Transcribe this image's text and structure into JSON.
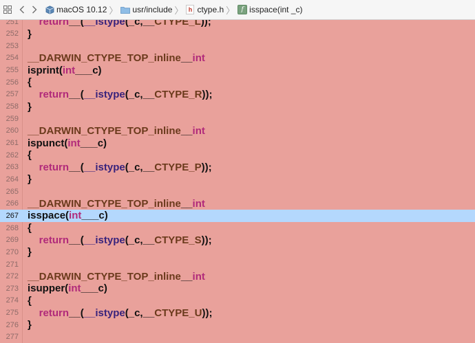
{
  "jumpbar": {
    "sdk": "macOS 10.12",
    "folder": "usr/include",
    "file": "ctype.h",
    "file_icon_glyph": "h",
    "symbol": "isspace(int _c)",
    "symbol_icon_glyph": "f",
    "icons": {
      "grid": "related-items-grid-icon",
      "back": "chevron-left-icon",
      "forward": "chevron-right-icon",
      "sdk": "sdk-box-icon",
      "folder": "folder-icon",
      "file": "header-file-icon",
      "symbol": "function-icon"
    }
  },
  "editor": {
    "current_line": "267",
    "colors": {
      "background": "#e9a19b",
      "current_line_highlight": "#b4d8fd",
      "keyword": "#b12a7a",
      "macro": "#6b3a1c",
      "identifier": "#39237c"
    },
    "lines": [
      {
        "num": "251",
        "t0": "    ",
        "t1": "return",
        "t2": "__(",
        "t3": "__istype",
        "t4": "(_c,__",
        "t5": "CTYPE_L",
        "t6": "));"
      },
      {
        "num": "252",
        "t0": "}",
        "t1": "",
        "t2": "",
        "t3": "",
        "t4": "",
        "t5": "",
        "t6": ""
      },
      {
        "num": "253",
        "t0": "",
        "t1": "",
        "t2": "",
        "t3": "",
        "t4": "",
        "t5": "",
        "t6": ""
      },
      {
        "num": "254",
        "t0": "",
        "t1": "__DARWIN_CTYPE_TOP_inline",
        "t2": "__",
        "t3": "int",
        "t4": "",
        "t5": "",
        "t6": ""
      },
      {
        "num": "255",
        "t0": "isprint(",
        "t1": "int",
        "t2": "__",
        "t3": "_c)",
        "t4": "",
        "t5": "",
        "t6": ""
      },
      {
        "num": "256",
        "t0": "{",
        "t1": "",
        "t2": "",
        "t3": "",
        "t4": "",
        "t5": "",
        "t6": ""
      },
      {
        "num": "257",
        "t0": "    ",
        "t1": "return",
        "t2": "__(",
        "t3": "__istype",
        "t4": "(_c,__",
        "t5": "CTYPE_R",
        "t6": "));"
      },
      {
        "num": "258",
        "t0": "}",
        "t1": "",
        "t2": "",
        "t3": "",
        "t4": "",
        "t5": "",
        "t6": ""
      },
      {
        "num": "259",
        "t0": "",
        "t1": "",
        "t2": "",
        "t3": "",
        "t4": "",
        "t5": "",
        "t6": ""
      },
      {
        "num": "260",
        "t0": "",
        "t1": "__DARWIN_CTYPE_TOP_inline",
        "t2": "__",
        "t3": "int",
        "t4": "",
        "t5": "",
        "t6": ""
      },
      {
        "num": "261",
        "t0": "ispunct(",
        "t1": "int",
        "t2": "__",
        "t3": "_c)",
        "t4": "",
        "t5": "",
        "t6": ""
      },
      {
        "num": "262",
        "t0": "{",
        "t1": "",
        "t2": "",
        "t3": "",
        "t4": "",
        "t5": "",
        "t6": ""
      },
      {
        "num": "263",
        "t0": "    ",
        "t1": "return",
        "t2": "__(",
        "t3": "__istype",
        "t4": "(_c,__",
        "t5": "CTYPE_P",
        "t6": "));"
      },
      {
        "num": "264",
        "t0": "}",
        "t1": "",
        "t2": "",
        "t3": "",
        "t4": "",
        "t5": "",
        "t6": ""
      },
      {
        "num": "265",
        "t0": "",
        "t1": "",
        "t2": "",
        "t3": "",
        "t4": "",
        "t5": "",
        "t6": ""
      },
      {
        "num": "266",
        "t0": "",
        "t1": "__DARWIN_CTYPE_TOP_inline",
        "t2": "__",
        "t3": "int",
        "t4": "",
        "t5": "",
        "t6": ""
      },
      {
        "num": "267",
        "t0": "isspace(",
        "t1": "int",
        "t2": "__",
        "t3": "_c)",
        "t4": "",
        "t5": "",
        "t6": ""
      },
      {
        "num": "268",
        "t0": "{",
        "t1": "",
        "t2": "",
        "t3": "",
        "t4": "",
        "t5": "",
        "t6": ""
      },
      {
        "num": "269",
        "t0": "    ",
        "t1": "return",
        "t2": "__(",
        "t3": "__istype",
        "t4": "(_c,__",
        "t5": "CTYPE_S",
        "t6": "));"
      },
      {
        "num": "270",
        "t0": "}",
        "t1": "",
        "t2": "",
        "t3": "",
        "t4": "",
        "t5": "",
        "t6": ""
      },
      {
        "num": "271",
        "t0": "",
        "t1": "",
        "t2": "",
        "t3": "",
        "t4": "",
        "t5": "",
        "t6": ""
      },
      {
        "num": "272",
        "t0": "",
        "t1": "__DARWIN_CTYPE_TOP_inline",
        "t2": "__",
        "t3": "int",
        "t4": "",
        "t5": "",
        "t6": ""
      },
      {
        "num": "273",
        "t0": "isupper(",
        "t1": "int",
        "t2": "__",
        "t3": "_c)",
        "t4": "",
        "t5": "",
        "t6": ""
      },
      {
        "num": "274",
        "t0": "{",
        "t1": "",
        "t2": "",
        "t3": "",
        "t4": "",
        "t5": "",
        "t6": ""
      },
      {
        "num": "275",
        "t0": "    ",
        "t1": "return",
        "t2": "__(",
        "t3": "__istype",
        "t4": "(_c,__",
        "t5": "CTYPE_U",
        "t6": "));"
      },
      {
        "num": "276",
        "t0": "}",
        "t1": "",
        "t2": "",
        "t3": "",
        "t4": "",
        "t5": "",
        "t6": ""
      },
      {
        "num": "277",
        "t0": "",
        "t1": "",
        "t2": "",
        "t3": "",
        "t4": "",
        "t5": "",
        "t6": ""
      }
    ]
  }
}
